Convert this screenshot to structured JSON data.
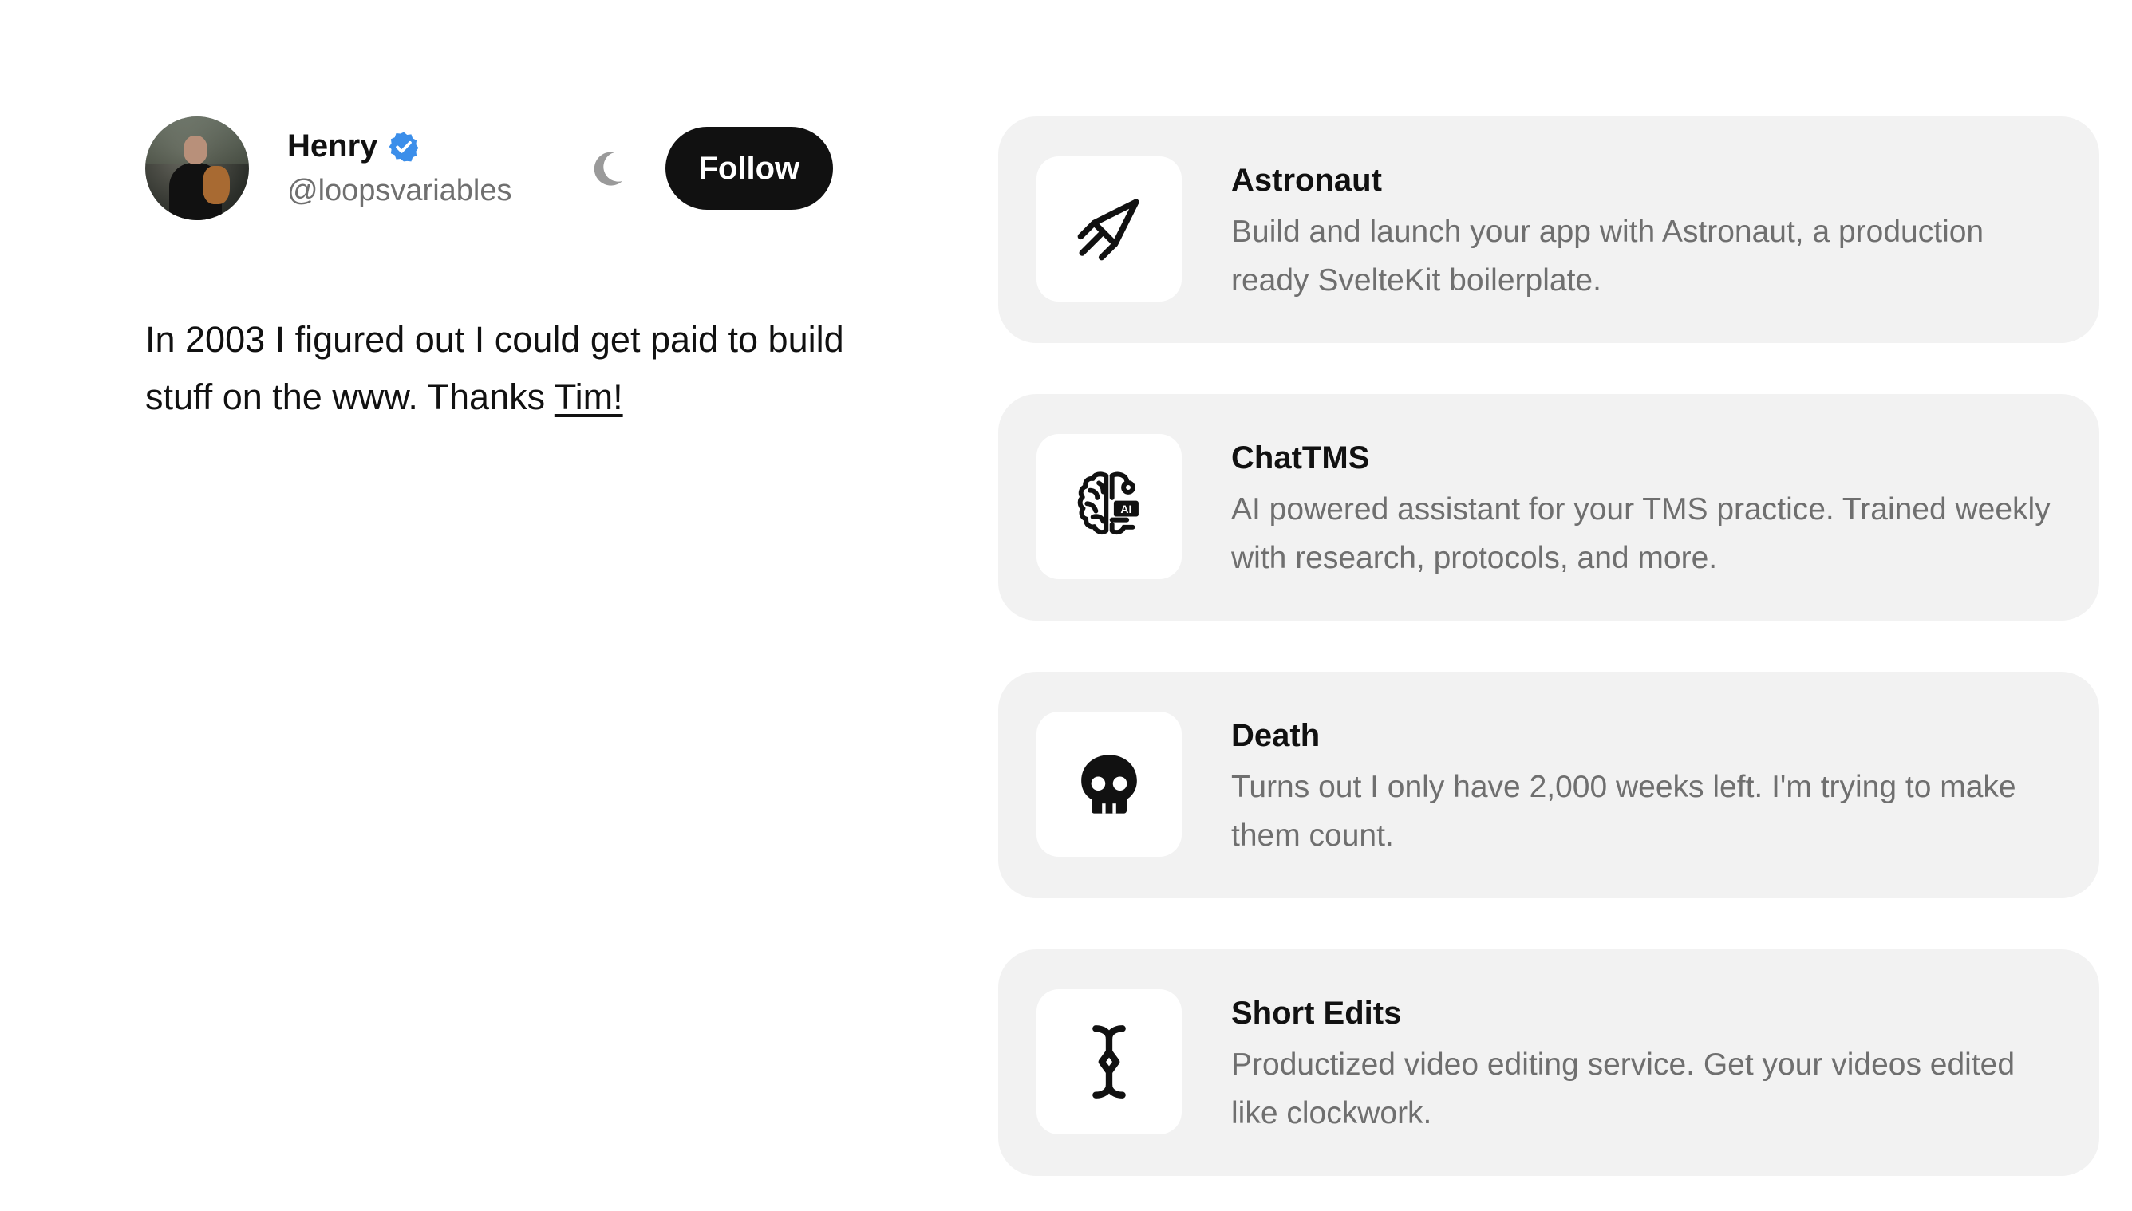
{
  "profile": {
    "name": "Henry",
    "handle": "@loopsvariables",
    "follow_label": "Follow",
    "bio_text": "In 2003 I figured out I could get paid to build stuff on the www. Thanks ",
    "bio_link": "Tim!",
    "verified_badge_color": "#3b8eea",
    "avatar_icon": "avatar-photo",
    "theme_icon": "moon-icon"
  },
  "projects": [
    {
      "title": "Astronaut",
      "description": "Build and launch your app with Astronaut, a production ready SvelteKit boilerplate.",
      "icon": "rocket-icon"
    },
    {
      "title": "ChatTMS",
      "description": "AI powered assistant for your TMS practice. Trained weekly with research, protocols, and more.",
      "icon": "ai-brain-icon",
      "icon_text": "AI"
    },
    {
      "title": "Death",
      "description": "Turns out I only have 2,000 weeks left. I'm trying to make them count.",
      "icon": "skull-icon"
    },
    {
      "title": "Short Edits",
      "description": "Productized video editing service. Get your videos edited like clockwork.",
      "icon": "text-cursor-icon"
    }
  ],
  "colors": {
    "background": "#ffffff",
    "card_background": "#f2f2f2",
    "primary_text": "#111111",
    "secondary_text": "#6f6f6f",
    "button_background": "#111111",
    "button_text": "#ffffff"
  }
}
